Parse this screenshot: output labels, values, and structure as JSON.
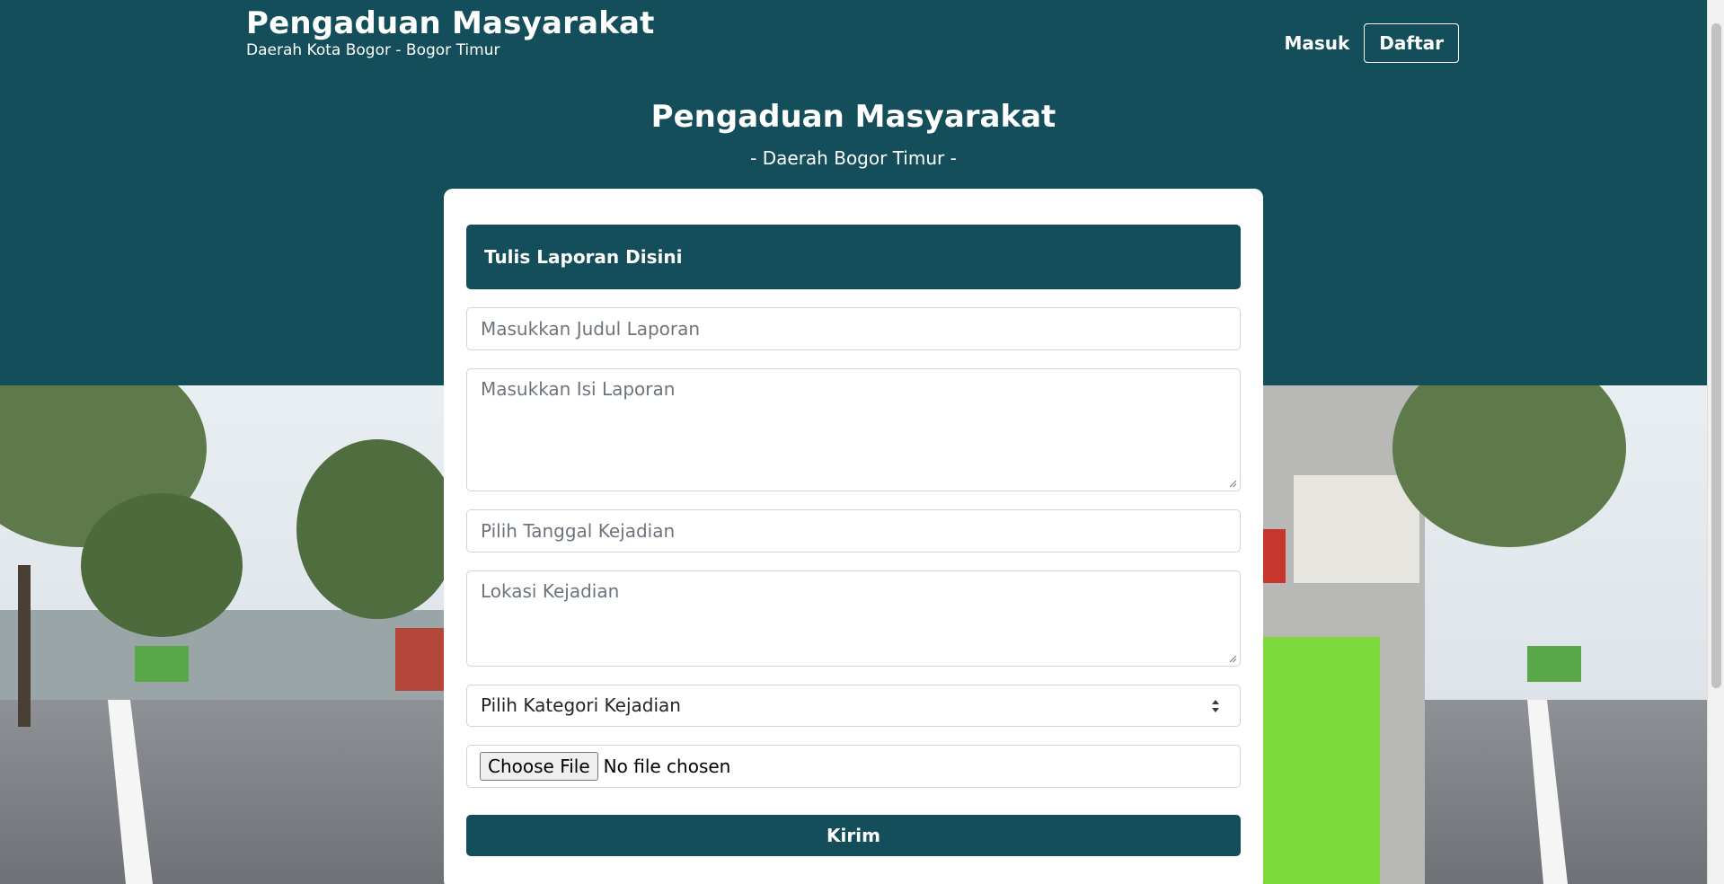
{
  "header": {
    "brand_title": "Pengaduan Masyarakat",
    "brand_subtitle": "Daerah Kota Bogor - Bogor Timur",
    "nav_login": "Masuk",
    "nav_register": "Daftar"
  },
  "hero": {
    "title": "Pengaduan Masyarakat",
    "subtitle": "- Daerah Bogor Timur -"
  },
  "form": {
    "heading": "Tulis Laporan Disini",
    "title_placeholder": "Masukkan Judul Laporan",
    "body_placeholder": "Masukkan Isi Laporan",
    "date_placeholder": "Pilih Tanggal Kejadian",
    "location_placeholder": "Lokasi Kejadian",
    "category_selected": "Pilih Kategori Kejadian",
    "file_button": "Choose File",
    "file_status": "No file chosen",
    "submit_label": "Kirim"
  },
  "colors": {
    "primary": "#134e5a",
    "background": "#ffffff"
  }
}
